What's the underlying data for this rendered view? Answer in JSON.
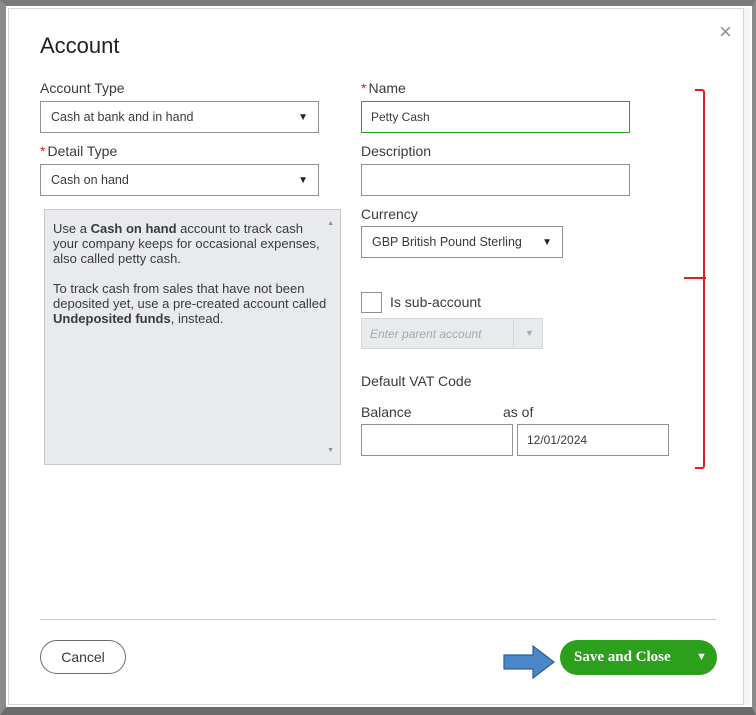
{
  "dialog": {
    "title": "Account",
    "close_symbol": "×"
  },
  "fields": {
    "account_type_label": "Account Type",
    "account_type_value": "Cash at bank and in hand",
    "name_required": "*",
    "name_label": "Name",
    "name_value": "Petty Cash",
    "detail_type_required": "*",
    "detail_type_label": "Detail Type",
    "detail_type_value": "Cash on hand",
    "description_label": "Description",
    "description_value": "",
    "currency_label": "Currency",
    "currency_value": "GBP British Pound Sterling",
    "sub_account_label": "Is sub-account",
    "sub_account_checked": false,
    "parent_account_placeholder": "Enter parent account",
    "default_vat_label": "Default VAT Code",
    "balance_label": "Balance",
    "balance_value": "",
    "as_of_label": "as of",
    "as_of_value": "12/01/2024"
  },
  "detail_help": {
    "p1_pre": "Use a ",
    "p1_bold": "Cash on hand",
    "p1_post": " account to track cash your company keeps for occasional expenses, also called petty cash.",
    "p2_pre": "To track cash from sales that have not been deposited yet, use a pre-created account called ",
    "p2_bold": "Undeposited funds",
    "p2_post": ", instead."
  },
  "footer": {
    "cancel_label": "Cancel",
    "save_label": "Save and Close"
  },
  "colors": {
    "primary_green": "#2ca01c",
    "required_red": "#e02020",
    "annotation_red": "#e02020",
    "annotation_arrow_blue": "#4a86c8"
  },
  "icons": {
    "close": "close-icon",
    "dropdown": "chevron-down-icon",
    "save_menu": "caret-down-icon",
    "annotation_arrow": "arrow-right-icon"
  }
}
